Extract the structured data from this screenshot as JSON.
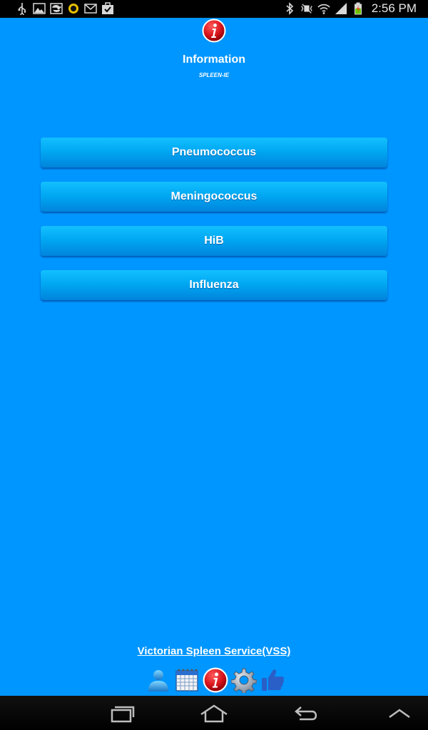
{
  "status_bar": {
    "time": "2:56 PM",
    "left_icons": [
      "usb-icon",
      "image-icon",
      "sync-icon",
      "bug-icon",
      "mail-icon",
      "briefcase-check-icon"
    ],
    "right_icons": [
      "bluetooth-icon",
      "vibrate-off-icon",
      "wifi-icon",
      "signal-icon",
      "battery-charging-icon"
    ]
  },
  "header": {
    "icon": "info-icon",
    "title": "Information",
    "subtitle": "SPLEEN-IE"
  },
  "menu": {
    "items": [
      {
        "label": "Pneumococcus"
      },
      {
        "label": "Meningococcus"
      },
      {
        "label": "HiB"
      },
      {
        "label": "Influenza"
      }
    ]
  },
  "footer": {
    "link_text": "Victorian Spleen Service(VSS)",
    "icons": [
      "person-icon",
      "calendar-icon",
      "info-icon",
      "gear-icon",
      "thumbs-up-icon"
    ]
  },
  "nav_bar": {
    "buttons": [
      "recent-apps-icon",
      "home-icon",
      "back-icon",
      "menu-up-icon"
    ]
  },
  "colors": {
    "background": "#0096ff",
    "button_top": "#14c0ff",
    "button_bottom": "#0084dc",
    "info_red": "#d8141c"
  }
}
